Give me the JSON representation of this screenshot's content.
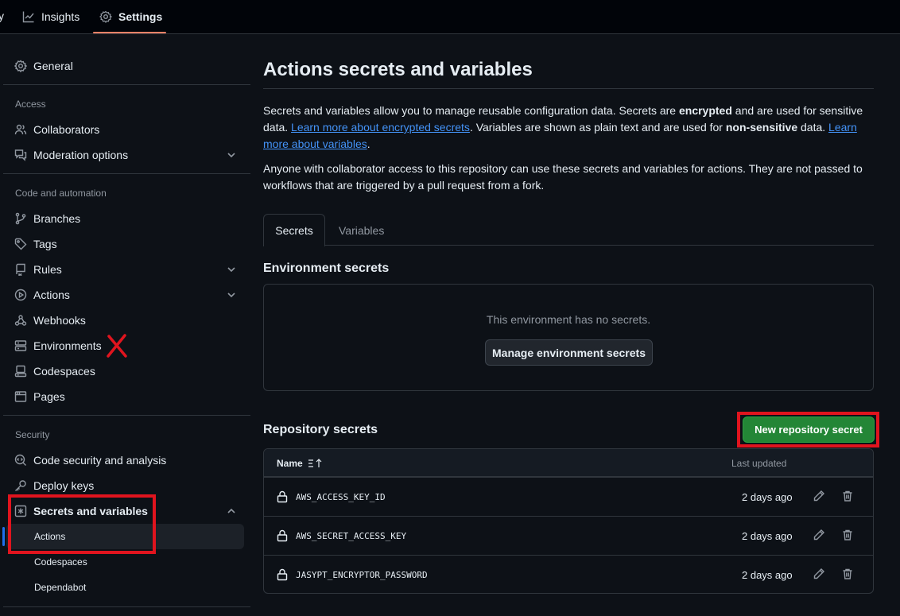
{
  "repo_tabs": {
    "insights_label": "Insights",
    "settings_label": "Settings"
  },
  "sidebar": {
    "general": "General",
    "access_heading": "Access",
    "collaborators": "Collaborators",
    "moderation": "Moderation options",
    "code_heading": "Code and automation",
    "branches": "Branches",
    "tags": "Tags",
    "rules": "Rules",
    "actions": "Actions",
    "webhooks": "Webhooks",
    "environments": "Environments",
    "codespaces": "Codespaces",
    "pages": "Pages",
    "security_heading": "Security",
    "code_security": "Code security and analysis",
    "deploy_keys": "Deploy keys",
    "secrets_vars": "Secrets and variables",
    "sub_actions": "Actions",
    "sub_codespaces": "Codespaces",
    "sub_dependabot": "Dependabot"
  },
  "main": {
    "title": "Actions secrets and variables",
    "p1_a": "Secrets and variables allow you to manage reusable configuration data. Secrets are ",
    "p1_b": "encrypted",
    "p1_c": " and are used for sensitive data. ",
    "p1_link1": "Learn more about encrypted secrets",
    "p1_d": ". Variables are shown as plain text and are used for ",
    "p1_e": "non-sensitive",
    "p1_f": " data. ",
    "p1_link2": "Learn more about variables",
    "p1_g": ".",
    "p2": "Anyone with collaborator access to this repository can use these secrets and variables for actions. They are not passed to workflows that are triggered by a pull request from a fork.",
    "tab_secrets": "Secrets",
    "tab_variables": "Variables",
    "env_heading": "Environment secrets",
    "env_empty": "This environment has no secrets.",
    "env_button": "Manage environment secrets",
    "repo_heading": "Repository secrets",
    "new_secret_button": "New repository secret",
    "table": {
      "col_name": "Name",
      "col_updated": "Last updated",
      "rows": [
        {
          "name": "AWS_ACCESS_KEY_ID",
          "updated": "2 days ago"
        },
        {
          "name": "AWS_SECRET_ACCESS_KEY",
          "updated": "2 days ago"
        },
        {
          "name": "JASYPT_ENCRYPTOR_PASSWORD",
          "updated": "2 days ago"
        }
      ]
    }
  },
  "colors": {
    "accent_link": "#4493f8",
    "primary_button": "#238636",
    "annotation_red": "#e0141e",
    "active_tab_underline": "#f78166"
  }
}
